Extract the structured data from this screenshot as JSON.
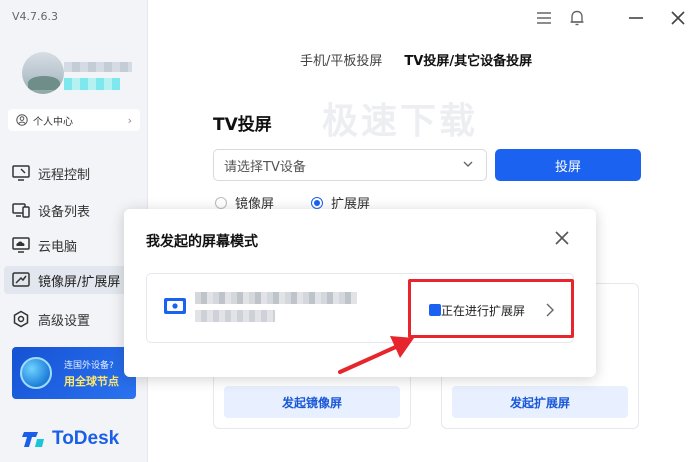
{
  "app": {
    "version": "V4.7.6.3",
    "logo_text": "ToDesk",
    "brand_color": "#1a62ef"
  },
  "sidebar": {
    "personal_center": "个人中心",
    "items": [
      {
        "label": "远程控制",
        "icon": "monitor-icon"
      },
      {
        "label": "设备列表",
        "icon": "devices-icon"
      },
      {
        "label": "云电脑",
        "icon": "cloud-pc-icon"
      },
      {
        "label": "镜像屏/扩展屏",
        "icon": "screen-extend-icon",
        "active": true
      },
      {
        "label": "高级设置",
        "icon": "settings-icon"
      }
    ],
    "promo": {
      "line1": "连国外设备?",
      "line2": "用全球节点"
    }
  },
  "tabs": [
    {
      "label": "手机/平板投屏",
      "active": false
    },
    {
      "label": "TV投屏/其它设备投屏",
      "active": true
    }
  ],
  "watermark": "极速下载",
  "tv_section": {
    "title": "TV投屏",
    "device_placeholder": "请选择TV设备",
    "cast_button": "投屏",
    "mode_options": [
      {
        "label": "镜像屏",
        "selected": false
      },
      {
        "label": "扩展屏",
        "selected": true
      }
    ]
  },
  "cards": [
    {
      "button": "发起镜像屏"
    },
    {
      "button": "发起扩展屏"
    }
  ],
  "dialog": {
    "title": "我发起的屏幕模式",
    "session_status": "正在进行扩展屏"
  }
}
